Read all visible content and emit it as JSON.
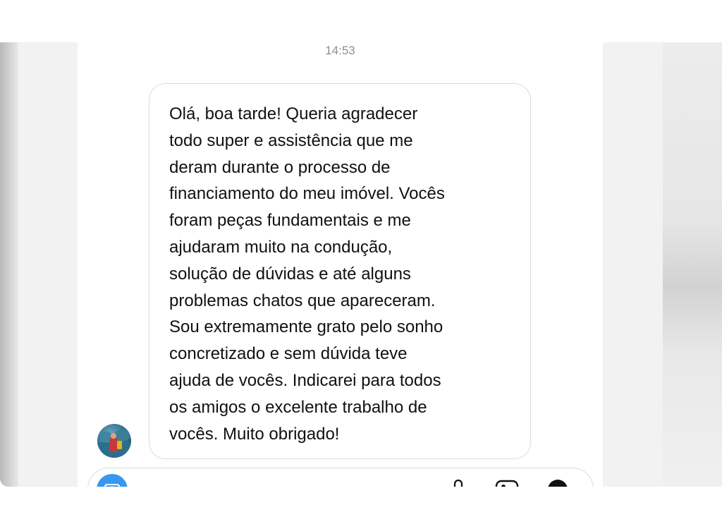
{
  "chat": {
    "timestamp": "14:53",
    "message": {
      "text": "Olá, boa tarde! Queria agradecer\ntodo super e assistência que me\nderam durante o processo de\nfinanciamento do meu imóvel. Vocês\nforam peças fundamentais e me\najudaram muito na condução,\nsolução de dúvidas e até alguns\nproblemas chatos que apareceram.\nSou extremamente grato pelo sonho\nconcretizado e sem dúvida teve\najuda de vocês. Indicarei para todos\nos amigos o excelente trabalho de\nvocês. Muito obrigado!",
      "sender_avatar_icon": "avatar-photo"
    }
  },
  "composer": {
    "left_icon": "camera-icon",
    "right_icons": [
      "microphone-icon",
      "image-icon",
      "sticker-icon"
    ],
    "camera_color": "#3897f0"
  }
}
